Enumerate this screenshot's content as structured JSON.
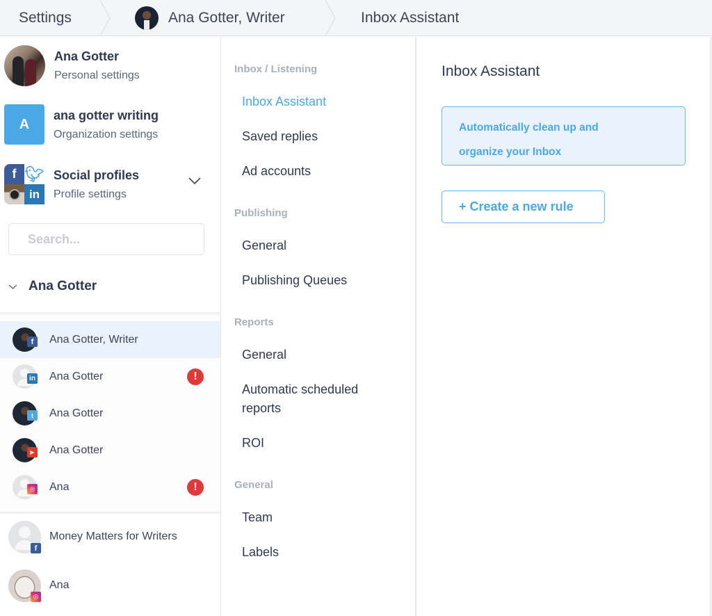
{
  "breadcrumb": {
    "root": "Settings",
    "profile": "Ana Gotter, Writer",
    "page": "Inbox Assistant"
  },
  "accounts": {
    "personal": {
      "title": "Ana Gotter",
      "subtitle": "Personal settings",
      "icon": "user-photo"
    },
    "organization": {
      "title": "ana gotter writing",
      "subtitle": "Organization settings",
      "initial": "A"
    },
    "social": {
      "title": "Social profiles",
      "subtitle": "Profile settings",
      "icons": [
        "facebook",
        "twitter",
        "instagram",
        "linkedin"
      ]
    }
  },
  "search": {
    "placeholder": "Search...",
    "value": ""
  },
  "group": {
    "name": "Ana Gotter",
    "expanded": true
  },
  "profiles": [
    {
      "name": "Ana Gotter, Writer",
      "network": "facebook",
      "badge": "f",
      "selected": true,
      "alert": false
    },
    {
      "name": "Ana Gotter",
      "network": "linkedin",
      "badge": "in",
      "selected": false,
      "alert": true
    },
    {
      "name": "Ana Gotter",
      "network": "twitter",
      "badge": "t",
      "selected": false,
      "alert": false
    },
    {
      "name": "Ana Gotter",
      "network": "youtube",
      "badge": "▶",
      "selected": false,
      "alert": false
    },
    {
      "name": "Ana",
      "network": "instagram",
      "badge": "◎",
      "selected": false,
      "alert": true
    }
  ],
  "other_profiles": [
    {
      "name": "Money Matters for Writers",
      "network": "facebook",
      "badge": "f"
    },
    {
      "name": "Ana",
      "network": "instagram",
      "badge": "◎"
    }
  ],
  "alert_glyph": "!",
  "nav": {
    "sections": [
      {
        "title": "Inbox / Listening",
        "items": [
          "Inbox Assistant",
          "Saved replies",
          "Ad accounts"
        ]
      },
      {
        "title": "Publishing",
        "items": [
          "General",
          "Publishing Queues"
        ]
      },
      {
        "title": "Reports",
        "items": [
          "General",
          "Automatic scheduled reports",
          "ROI"
        ]
      },
      {
        "title": "General",
        "items": [
          "Team",
          "Labels"
        ]
      }
    ],
    "active": "Inbox Assistant"
  },
  "main": {
    "title": "Inbox Assistant",
    "info_line1": "Automatically clean up and",
    "info_line2": "organize your Inbox",
    "create_button": "+ Create a new rule"
  },
  "colors": {
    "accent": "#4aa8e6",
    "selected_bg": "#eaf3fc",
    "alert": "#e0393a",
    "text": "#2f3a4f",
    "section_label": "#a9b0ba"
  }
}
